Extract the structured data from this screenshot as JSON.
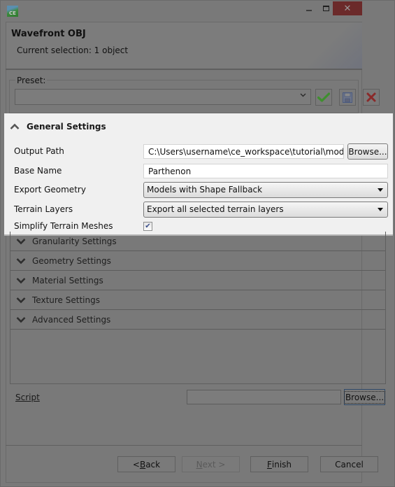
{
  "window": {
    "app_icon_text": "CE",
    "close_glyph": "✕"
  },
  "header": {
    "title": "Wavefront OBJ",
    "subtitle": "Current selection: 1 object"
  },
  "preset": {
    "label": "Preset:",
    "value": "",
    "chevron": "⌄",
    "buttons": {
      "apply": "apply-preset",
      "save": "save-preset",
      "delete": "delete-preset"
    }
  },
  "general_settings": {
    "title": "General Settings",
    "expanded": true,
    "output_path": {
      "label": "Output Path",
      "value": "C:\\Users\\username\\ce_workspace\\tutorial\\models",
      "browse_label": "Browse..."
    },
    "base_name": {
      "label": "Base Name",
      "value": "Parthenon"
    },
    "export_geometry": {
      "label": "Export Geometry",
      "selected": "Models with Shape Fallback"
    },
    "terrain_layers": {
      "label": "Terrain Layers",
      "selected": "Export all selected terrain layers"
    },
    "simplify_terrain_meshes": {
      "label": "Simplify Terrain Meshes",
      "checked": true,
      "check_glyph": "✔"
    }
  },
  "collapsed_sections": [
    {
      "label": "Granularity Settings"
    },
    {
      "label": "Geometry Settings"
    },
    {
      "label": "Material Settings"
    },
    {
      "label": "Texture Settings"
    },
    {
      "label": "Advanced Settings"
    }
  ],
  "script": {
    "label": "Script",
    "value": "",
    "browse_label": "Browse..."
  },
  "footer": {
    "back_prefix": "< ",
    "back_mnemonic": "B",
    "back_rest": "ack",
    "next_mnemonic": "N",
    "next_rest": "ext >",
    "finish_mnemonic": "F",
    "finish_rest": "inish",
    "cancel": "Cancel"
  },
  "colors": {
    "highlight_panel": "#f0f0f0",
    "dim_overlay": "#797979",
    "close_button": "#6b2a2a",
    "apply_green": "#3f8f2f",
    "delete_red": "#8a2a2a",
    "save_blue": "#4a5a80"
  }
}
